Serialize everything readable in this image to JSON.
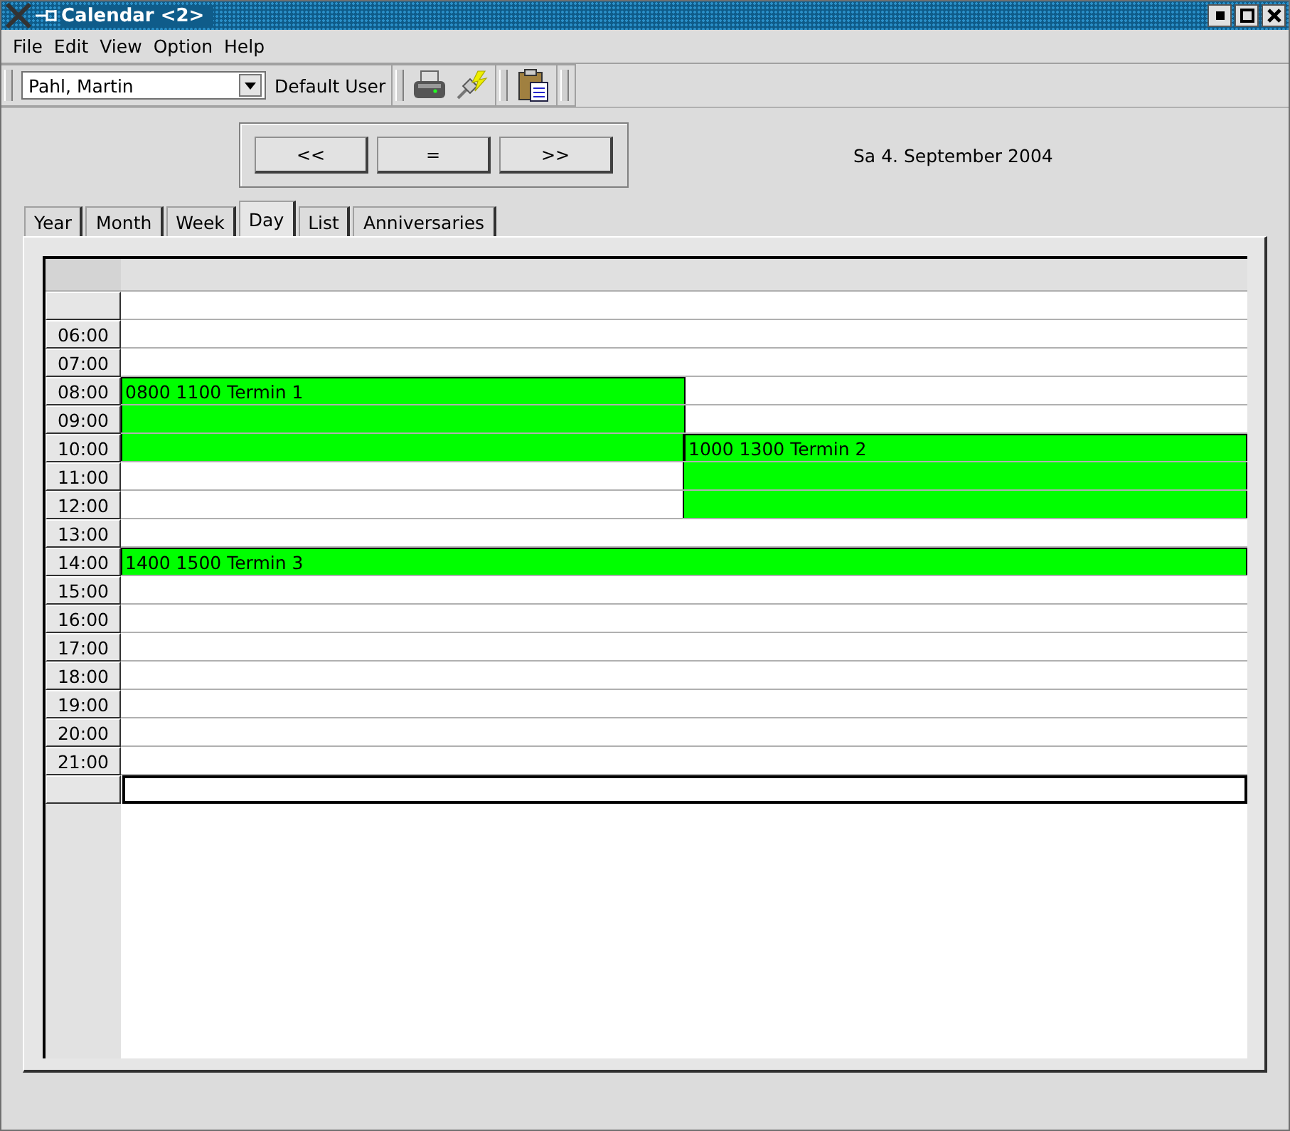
{
  "window": {
    "title": "Calendar <2>"
  },
  "menu": [
    {
      "label": "File"
    },
    {
      "label": "Edit"
    },
    {
      "label": "View"
    },
    {
      "label": "Option"
    },
    {
      "label": "Help"
    }
  ],
  "toolbar": {
    "user_select": "Pahl, Martin",
    "user_label": "Default User"
  },
  "navigation": {
    "buttons": [
      "<<",
      "=",
      ">>"
    ],
    "date": "Sa 4. September 2004"
  },
  "tabs": [
    {
      "label": "Year",
      "selected": false
    },
    {
      "label": "Month",
      "selected": false
    },
    {
      "label": "Week",
      "selected": false
    },
    {
      "label": "Day",
      "selected": true
    },
    {
      "label": "List",
      "selected": false
    },
    {
      "label": "Anniversaries",
      "selected": false
    }
  ],
  "day_rows": [
    {
      "selected": false,
      "lanes": []
    },
    {
      "time": "06:00",
      "selected": false,
      "lanes": []
    },
    {
      "time": "07:00",
      "selected": false,
      "lanes": []
    },
    {
      "time": "08:00",
      "selected": false,
      "lanes": [
        {
          "kind": "start",
          "label": "0800 1100 Termin 1"
        },
        {
          "kind": "free"
        }
      ]
    },
    {
      "time": "09:00",
      "selected": false,
      "lanes": [
        {
          "kind": "busy"
        },
        {
          "kind": "free"
        }
      ]
    },
    {
      "time": "10:00",
      "selected": false,
      "lanes": [
        {
          "kind": "busy"
        },
        {
          "kind": "start",
          "label": "1000 1300 Termin 2"
        }
      ]
    },
    {
      "time": "11:00",
      "selected": false,
      "lanes": [
        {
          "kind": "free"
        },
        {
          "kind": "busy"
        }
      ]
    },
    {
      "time": "12:00",
      "selected": false,
      "lanes": [
        {
          "kind": "free"
        },
        {
          "kind": "busy"
        }
      ]
    },
    {
      "time": "13:00",
      "selected": false,
      "lanes": []
    },
    {
      "time": "14:00",
      "selected": false,
      "lanes": [
        {
          "kind": "start",
          "label": "1400 1500 Termin 3"
        }
      ]
    },
    {
      "time": "15:00",
      "selected": false,
      "lanes": []
    },
    {
      "time": "16:00",
      "selected": false,
      "lanes": []
    },
    {
      "time": "17:00",
      "selected": false,
      "lanes": []
    },
    {
      "time": "18:00",
      "selected": false,
      "lanes": []
    },
    {
      "time": "19:00",
      "selected": false,
      "lanes": []
    },
    {
      "time": "20:00",
      "selected": false,
      "lanes": []
    },
    {
      "time": "21:00",
      "selected": false,
      "lanes": []
    },
    {
      "selected": true,
      "lanes": []
    }
  ]
}
